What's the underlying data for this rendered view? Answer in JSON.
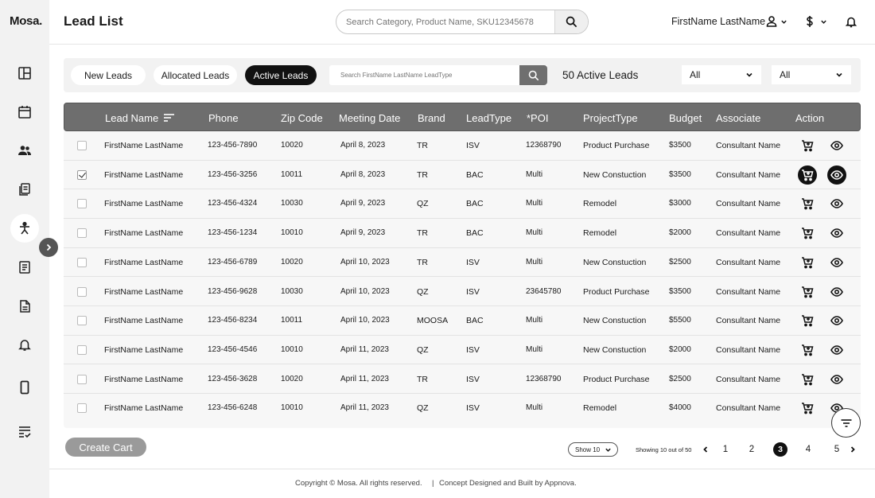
{
  "app": {
    "logo": "Mosa."
  },
  "header": {
    "title": "Lead List",
    "search_placeholder": "Search Category, Product Name, SKU12345678",
    "user_name": "FirstName LastName"
  },
  "sidebar": {
    "items": [
      {
        "name": "dashboard-icon"
      },
      {
        "name": "calendar-icon"
      },
      {
        "name": "people-icon"
      },
      {
        "name": "documents-icon"
      },
      {
        "name": "leads-icon",
        "active": true
      },
      {
        "name": "list-icon"
      },
      {
        "name": "file-icon"
      },
      {
        "name": "bell-icon"
      },
      {
        "name": "mobile-icon"
      },
      {
        "name": "checklist-icon"
      }
    ]
  },
  "toolbar": {
    "tabs": [
      {
        "label": "New Leads",
        "active": false
      },
      {
        "label": "Allocated Leads",
        "active": false
      },
      {
        "label": "Active Leads",
        "active": true
      }
    ],
    "search_placeholder": "Search FirstName LastName LeadType",
    "active_count": "50 Active Leads",
    "filter1": "All",
    "filter2": "All"
  },
  "table": {
    "headers": {
      "lead_name": "Lead Name",
      "phone": "Phone",
      "zip": "Zip Code",
      "meeting": "Meeting Date",
      "brand": "Brand",
      "lead_type": "LeadType",
      "poi": "*POI",
      "project_type": "ProjectType",
      "budget": "Budget",
      "associate": "Associate",
      "action": "Action"
    },
    "rows": [
      {
        "checked": false,
        "name": "FirstName LastName",
        "phone": "123-456-7890",
        "zip": "10020",
        "date": "April 8, 2023",
        "brand": "TR",
        "type": "ISV",
        "poi": "12368790",
        "project": "Product Purchase",
        "budget": "$3500",
        "associate": "Consultant Name"
      },
      {
        "checked": true,
        "name": "FirstName LastName",
        "phone": "123-456-3256",
        "zip": "10011",
        "date": "April 8, 2023",
        "brand": "TR",
        "type": "BAC",
        "poi": "Multi",
        "project": "New Constuction",
        "budget": "$3500",
        "associate": "Consultant Name"
      },
      {
        "checked": false,
        "name": "FirstName LastName",
        "phone": "123-456-4324",
        "zip": "10030",
        "date": "April 9, 2023",
        "brand": "QZ",
        "type": "BAC",
        "poi": "Multi",
        "project": "Remodel",
        "budget": "$3000",
        "associate": "Consultant Name"
      },
      {
        "checked": false,
        "name": "FirstName LastName",
        "phone": "123-456-1234",
        "zip": "10010",
        "date": "April 9, 2023",
        "brand": "TR",
        "type": "BAC",
        "poi": "Multi",
        "project": "Remodel",
        "budget": "$2000",
        "associate": "Consultant Name"
      },
      {
        "checked": false,
        "name": "FirstName LastName",
        "phone": "123-456-6789",
        "zip": "10020",
        "date": "April 10, 2023",
        "brand": "TR",
        "type": "ISV",
        "poi": "Multi",
        "project": "New Constuction",
        "budget": "$2500",
        "associate": "Consultant Name"
      },
      {
        "checked": false,
        "name": "FirstName LastName",
        "phone": "123-456-9628",
        "zip": "10030",
        "date": "April 10, 2023",
        "brand": "QZ",
        "type": "ISV",
        "poi": "23645780",
        "project": "Product Purchase",
        "budget": "$3500",
        "associate": "Consultant Name"
      },
      {
        "checked": false,
        "name": "FirstName LastName",
        "phone": "123-456-8234",
        "zip": "10011",
        "date": "April 10, 2023",
        "brand": "MOOSA",
        "type": "BAC",
        "poi": "Multi",
        "project": "New Constuction",
        "budget": "$5500",
        "associate": "Consultant Name"
      },
      {
        "checked": false,
        "name": "FirstName LastName",
        "phone": "123-456-4546",
        "zip": "10010",
        "date": "April 11, 2023",
        "brand": "QZ",
        "type": "ISV",
        "poi": "Multi",
        "project": "New Constuction",
        "budget": "$2000",
        "associate": "Consultant Name"
      },
      {
        "checked": false,
        "name": "FirstName LastName",
        "phone": "123-456-3628",
        "zip": "10020",
        "date": "April 11, 2023",
        "brand": "TR",
        "type": "ISV",
        "poi": "12368790",
        "project": "Product Purchase",
        "budget": "$2500",
        "associate": "Consultant Name"
      },
      {
        "checked": false,
        "name": "FirstName LastName",
        "phone": "123-456-6248",
        "zip": "10010",
        "date": "April 11, 2023",
        "brand": "QZ",
        "type": "ISV",
        "poi": "Multi",
        "project": "Remodel",
        "budget": "$4000",
        "associate": "Consultant Name"
      }
    ]
  },
  "footer_controls": {
    "create_cart": "Create Cart",
    "show": "Show 10",
    "showing": "Showing 10 out of 50",
    "pages": [
      "1",
      "2",
      "3",
      "4",
      "5"
    ],
    "current_page": "3"
  },
  "footer": {
    "copyright": "Copyright © Mosa. All rights reserved.",
    "separator": "|",
    "credit": "Concept Designed and Built by Appnova."
  }
}
